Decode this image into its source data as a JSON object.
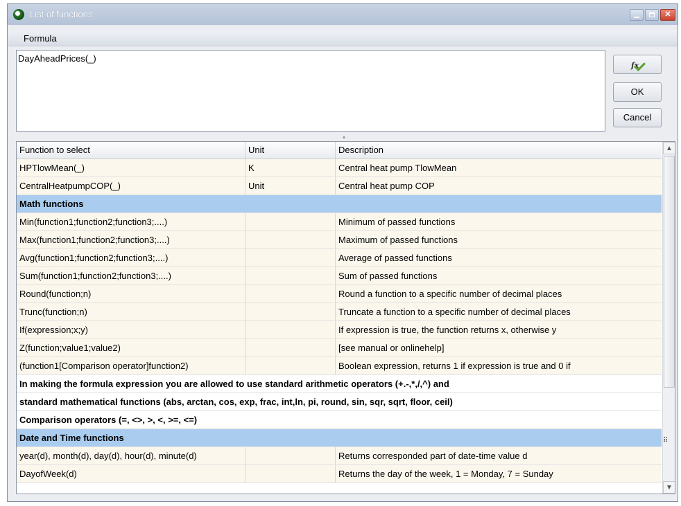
{
  "window": {
    "title": "List of functions"
  },
  "group_header": "Formula",
  "formula_text": "DayAheadPrices(_)",
  "buttons": {
    "fx_label": "fx",
    "ok_label": "OK",
    "cancel_label": "Cancel"
  },
  "table": {
    "headers": [
      "Function to select",
      "Unit",
      "Description"
    ],
    "rows": [
      {
        "type": "data",
        "function": "HPTlowMean(_)",
        "unit": "K",
        "description": "Central heat pump TlowMean"
      },
      {
        "type": "data",
        "function": "CentralHeatpumpCOP(_)",
        "unit": "Unit",
        "description": "Central heat pump COP"
      },
      {
        "type": "group",
        "text": "Math functions"
      },
      {
        "type": "data",
        "function": "Min(function1;function2;function3;....)",
        "unit": "",
        "description": "Minimum of passed functions"
      },
      {
        "type": "data",
        "function": "Max(function1;function2;function3;....)",
        "unit": "",
        "description": "Maximum of passed functions"
      },
      {
        "type": "data",
        "function": "Avg(function1;function2;function3;....)",
        "unit": "",
        "description": "Average of passed functions"
      },
      {
        "type": "data",
        "function": "Sum(function1;function2;function3;....)",
        "unit": "",
        "description": "Sum of passed functions"
      },
      {
        "type": "data",
        "function": "Round(function;n)",
        "unit": "",
        "description": "Round a function to a specific number of decimal places"
      },
      {
        "type": "data",
        "function": "Trunc(function;n)",
        "unit": "",
        "description": "Truncate a function to a specific number of decimal places"
      },
      {
        "type": "data",
        "function": "If(expression;x;y)",
        "unit": "",
        "description": "If expression is true, the function returns x, otherwise y"
      },
      {
        "type": "data",
        "function": "Z(function;value1;value2)",
        "unit": "",
        "description": "[see manual or onlinehelp]"
      },
      {
        "type": "data",
        "function": "(function1[Comparison operator]function2)",
        "unit": "",
        "description": "Boolean expression, returns 1 if expression is true and 0 if"
      },
      {
        "type": "info",
        "text": "In making the formula expression you are allowed to use standard arithmetic operators (+.-,*,/,^) and"
      },
      {
        "type": "info",
        "text": "standard mathematical functions (abs, arctan, cos, exp, frac, int,ln, pi, round, sin, sqr, sqrt, floor, ceil)"
      },
      {
        "type": "info",
        "text": "Comparison operators (=, <>, >, <, >=, <=)"
      },
      {
        "type": "group",
        "text": "Date and Time functions"
      },
      {
        "type": "data",
        "function": "year(d), month(d), day(d), hour(d), minute(d)",
        "unit": "",
        "description": "Returns corresponded part of date-time value d"
      },
      {
        "type": "data",
        "function": "DayofWeek(d)",
        "unit": "",
        "description": "Returns the day of the week, 1 = Monday, 7 = Sunday"
      }
    ]
  },
  "colors": {
    "group_row": "#aacdef",
    "data_row": "#fcf7ec",
    "close_button": "#c8422e"
  },
  "icons": {
    "app": "app-icon",
    "fx": "fx-check-icon",
    "scroll_up": "chevron-up-icon",
    "scroll_down": "chevron-down-icon"
  }
}
